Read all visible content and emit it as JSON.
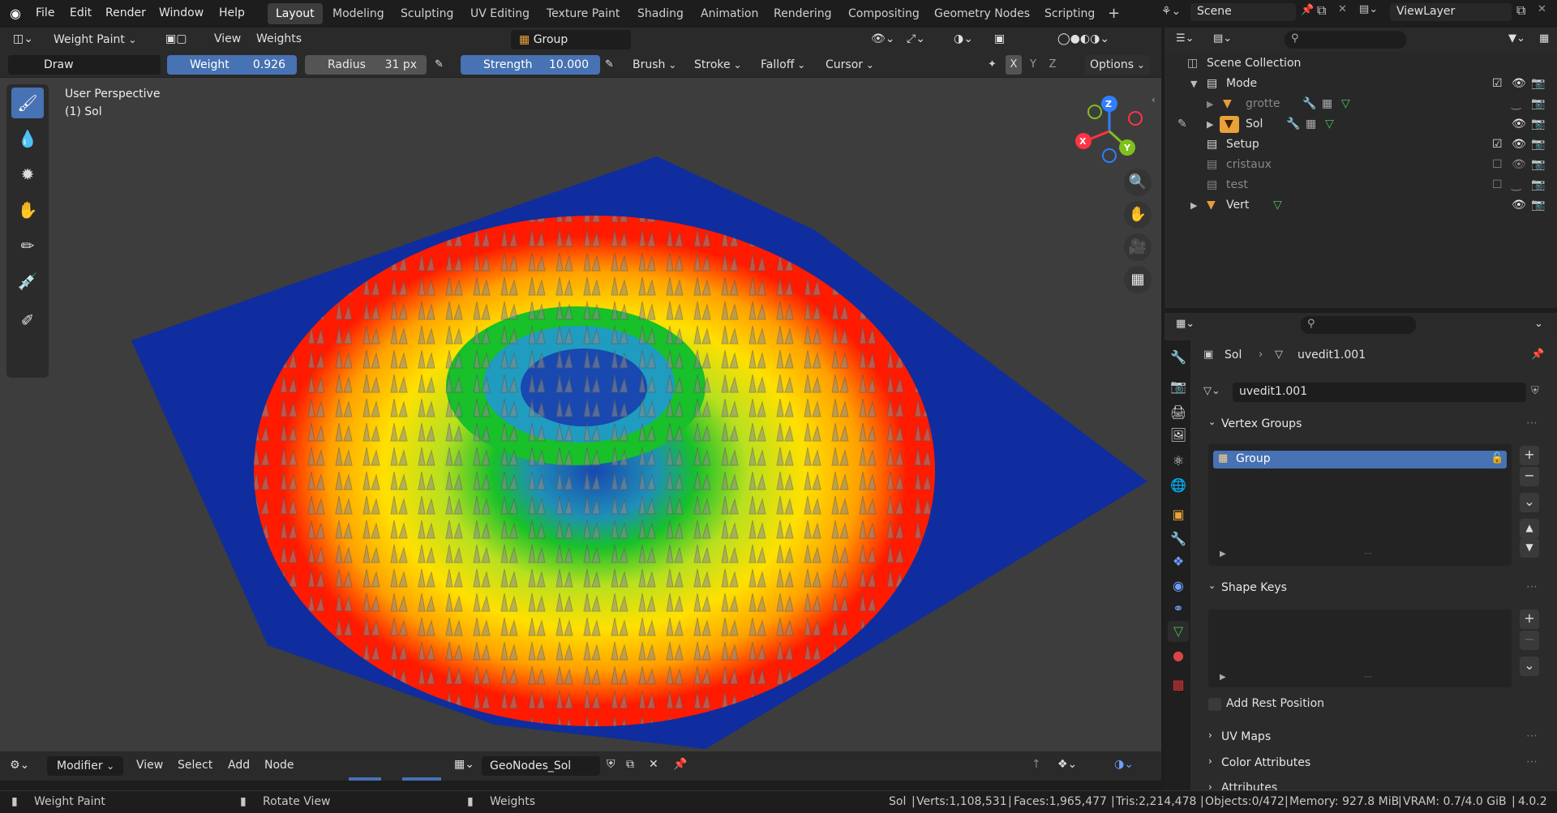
{
  "menu": [
    "File",
    "Edit",
    "Render",
    "Window",
    "Help"
  ],
  "workspaces": [
    "Layout",
    "Modeling",
    "Sculpting",
    "UV Editing",
    "Texture Paint",
    "Shading",
    "Animation",
    "Rendering",
    "Compositing",
    "Geometry Nodes",
    "Scripting"
  ],
  "active_workspace": "Layout",
  "scene": "Scene",
  "view_layer": "ViewLayer",
  "viewport": {
    "mode": "Weight Paint",
    "menus": [
      "View",
      "Weights"
    ],
    "vertex_group": "Group",
    "tool_name": "Draw",
    "weight_label": "Weight",
    "weight_value": "0.926",
    "radius_label": "Radius",
    "radius_value": "31 px",
    "strength_label": "Strength",
    "strength_value": "10.000",
    "brush": "Brush",
    "stroke": "Stroke",
    "falloff": "Falloff",
    "cursor": "Cursor",
    "axes": [
      "X",
      "Y",
      "Z"
    ],
    "options": "Options",
    "perspective": "User Perspective",
    "object": "(1) Sol",
    "gizmo": {
      "x": "X",
      "y": "Y",
      "z": "Z"
    }
  },
  "outliner": {
    "root": "Scene Collection",
    "rows": [
      {
        "name": "Mode",
        "kind": "collection"
      },
      {
        "name": "grotte",
        "kind": "object"
      },
      {
        "name": "Sol",
        "kind": "object"
      },
      {
        "name": "Setup",
        "kind": "collection"
      },
      {
        "name": "cristaux",
        "kind": "collection"
      },
      {
        "name": "test",
        "kind": "collection"
      },
      {
        "name": "Vert",
        "kind": "object"
      }
    ]
  },
  "properties": {
    "breadcrumb_object": "Sol",
    "breadcrumb_data": "uvedit1.001",
    "mesh_name": "uvedit1.001",
    "vertex_groups_title": "Vertex Groups",
    "vertex_groups": [
      "Group"
    ],
    "shape_keys_title": "Shape Keys",
    "add_rest_position": "Add Rest Position",
    "uv_maps_title": "UV Maps",
    "color_attributes_title": "Color Attributes",
    "attributes_title": "Attributes"
  },
  "node_editor": {
    "type": "Modifier",
    "menus": [
      "View",
      "Select",
      "Add",
      "Node"
    ],
    "tree_name": "GeoNodes_Sol"
  },
  "status": {
    "mode": "Weight Paint",
    "mouse_mid": "Rotate View",
    "mouse_right": "Weights",
    "object": "Sol",
    "verts": "Verts:1,108,531",
    "faces": "Faces:1,965,477",
    "tris": "Tris:2,214,478",
    "objects": "Objects:0/472",
    "memory": "Memory: 927.8 MiB",
    "vram": "VRAM: 0.7/4.0 GiB",
    "version": "4.0.2"
  },
  "colors": {
    "accent": "#4772b3",
    "weight_red": "#ff1a00",
    "weight_yellow": "#ffe000",
    "weight_green": "#18c02a",
    "weight_blue": "#0d2a9a"
  }
}
